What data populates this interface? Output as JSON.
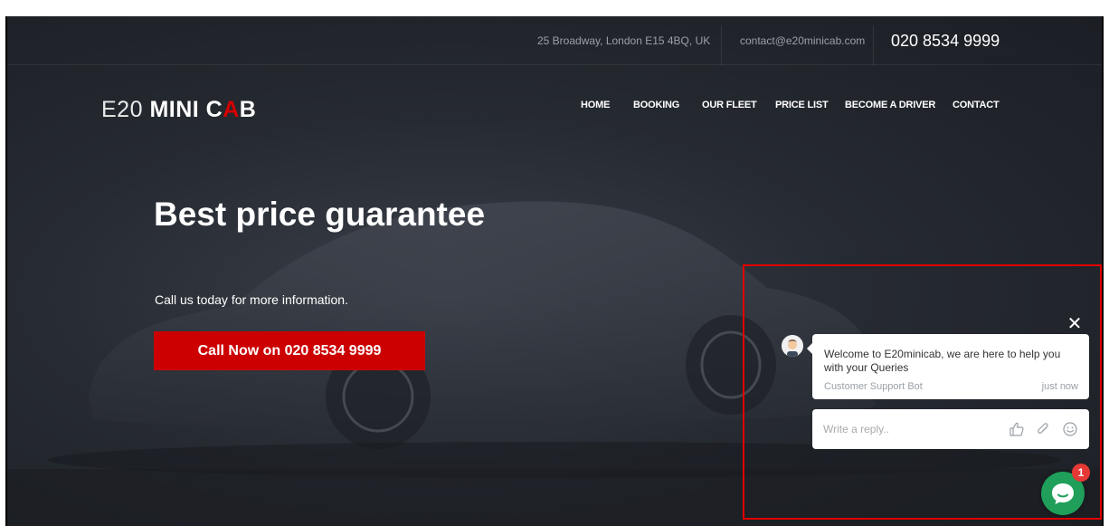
{
  "topbar": {
    "address": "25 Broadway, London E15 4BQ, UK",
    "email": "contact@e20minicab.com",
    "phone": "020 8534 9999"
  },
  "logo": {
    "part1": "E20",
    "part2": "MINI C",
    "part3": "A",
    "part4": "B"
  },
  "nav": {
    "items": [
      {
        "label": "HOME"
      },
      {
        "label": "BOOKING"
      },
      {
        "label": "OUR FLEET"
      },
      {
        "label": "PRICE LIST"
      },
      {
        "label": "BECOME A DRIVER"
      },
      {
        "label": "CONTACT"
      }
    ]
  },
  "hero": {
    "title": "Best price guarantee",
    "subtitle": "Call us today for more information.",
    "cta_label": "Call Now on 020 8534 9999"
  },
  "chat": {
    "close_icon": "close-icon",
    "message": "Welcome to E20minicab, we are here to help you with your Queries",
    "sender": "Customer Support Bot",
    "time": "just now",
    "reply_placeholder": "Write a reply..",
    "reply_icons": [
      "thumbs-up-icon",
      "paperclip-icon",
      "smiley-icon"
    ],
    "unread_count": "1"
  },
  "colors": {
    "accent_red": "#cc0000",
    "chat_green": "#1f9f5a",
    "badge_red": "#e53935",
    "highlight_border": "#e00000"
  }
}
